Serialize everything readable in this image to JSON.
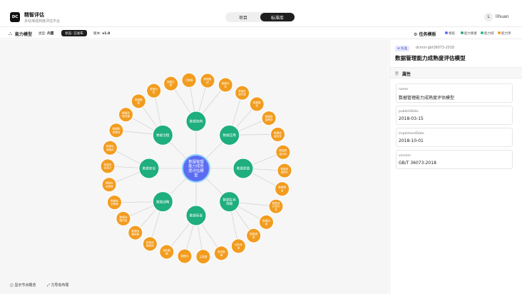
{
  "app": {
    "logo": "DC",
    "title": "精智评估",
    "subtitle": "多标准成熟度评估平台"
  },
  "nav": {
    "tabs": [
      {
        "label": "项目"
      },
      {
        "label": "标准库"
      }
    ],
    "active": 1
  },
  "user": {
    "initial": "L",
    "name": "lihuan"
  },
  "toolbar": {
    "icon": "model-icon",
    "title": "能力模型",
    "type_label": "类型:",
    "type_value": "内置",
    "status_label": "状态: 已发布",
    "version_label": "版本:",
    "version_value": "v1.0",
    "template_label": "任务模板",
    "legend": [
      {
        "label": "根股",
        "color": "#5b6cf2"
      },
      {
        "label": "能力要素",
        "color": "#3aa37a"
      },
      {
        "label": "能力域",
        "color": "#2bb68a"
      },
      {
        "label": "能力项",
        "color": "#f0a02a"
      }
    ]
  },
  "graph": {
    "root": {
      "label": "数据管理能力成熟度评估模型",
      "color": "#5b6cf2"
    },
    "domain_color": "#1fae7e",
    "item_color": "#f29c1f",
    "domains": [
      {
        "label": "数据架构"
      },
      {
        "label": "数据应用"
      },
      {
        "label": "数据质量"
      },
      {
        "label": "数据生存周期"
      },
      {
        "label": "数据标准"
      },
      {
        "label": "数据战略"
      },
      {
        "label": "数据安全"
      },
      {
        "label": "数据治理"
      }
    ],
    "items": [
      "元数据",
      "数据集成",
      "数据分析",
      "数据开放共享",
      "数据服务",
      "数据质量需求",
      "数据质量检查",
      "数据质量分析",
      "数据质量提升",
      "数据需求",
      "数据设计和开发",
      "数据运维",
      "数据退役",
      "业务术语",
      "参考数据",
      "主数据",
      "数据元",
      "指标数据",
      "数据战略规划",
      "数据战略实施",
      "数据战略评估",
      "数据安全策略",
      "数据安全管理",
      "数据安全审计",
      "数据治理组织",
      "数据制度建设",
      "数据治理沟通",
      "数据模型",
      "数据分布",
      "数据交换"
    ]
  },
  "bottom": {
    "left": "显示节点概览",
    "right": "力导向布局"
  },
  "panel": {
    "tag": "标准",
    "id": "dcmm-gbt36073-2018",
    "title": "数据管理能力成熟度评估模型",
    "section": "属性",
    "fields": [
      {
        "key": "name",
        "value": "数据管理能力成熟度评估模型"
      },
      {
        "key": "publishDate",
        "value": "2018-03-15"
      },
      {
        "key": "implementDate",
        "value": "2018-10-01"
      },
      {
        "key": "version",
        "value": "GB/T 36073-2018"
      }
    ]
  }
}
